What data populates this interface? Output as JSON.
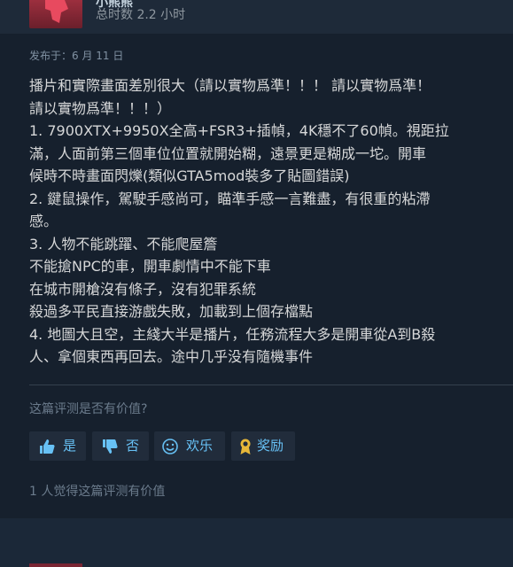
{
  "reviewer": {
    "name": "小熊熊",
    "hours_label": "总时数 2.2 小时"
  },
  "posted": "发布于：6 月 11 日",
  "review_lines": [
    "播片和實際畫面差別很大（請以實物爲準！！！ 請以實物爲準！",
    "請以實物爲準！！！）",
    "1. 7900XTX+9950X全高+FSR3+插幀，4K穩不了60幀。視距拉",
    "滿，人面前第三個車位位置就開始糊，遠景更是糊成一坨。開車",
    "候時不時畫面閃爍(類似GTA5mod裝多了貼圖錯誤)",
    "2. 鍵鼠操作，駕駛手感尚可，瞄準手感一言難盡，有很重的粘滯",
    "感。",
    "3. 人物不能跳躍、不能爬屋簷",
    "不能搶NPC的車，開車劇情中不能下車",
    "在城市開槍沒有條子，沒有犯罪系統",
    "殺過多平民直接游戲失敗，加載到上個存檔點",
    "4. 地圖大且空，主綫大半是播片，任務流程大多是開車從A到B殺",
    "人、拿個東西再回去。途中几乎没有隨機事件"
  ],
  "helpful_question": "这篇评测是否有价值?",
  "votes": {
    "yes_label": "是",
    "no_label": "否",
    "funny_label": "欢乐",
    "award_label": "奖励"
  },
  "helpful_count": "1 人觉得这篇评测有价值",
  "colors": {
    "page_bg": "#1b2838",
    "card_bg": "#16202d",
    "body_text": "#d6d7d8",
    "muted_text": "#6b7b8c",
    "button_bg": "#212c3b",
    "button_text": "#67c1f5"
  }
}
